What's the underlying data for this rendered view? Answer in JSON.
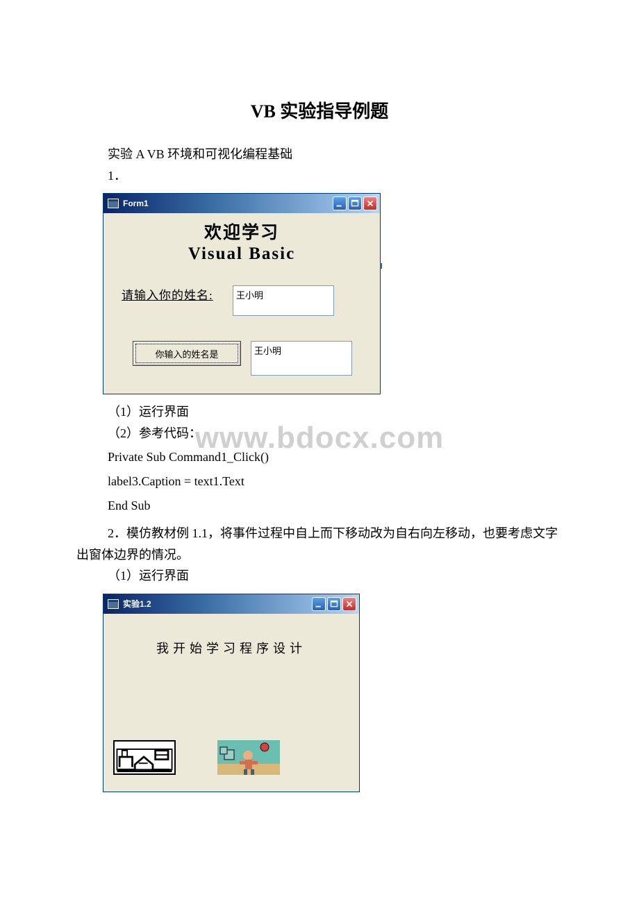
{
  "doc": {
    "title": "VB 实验指导例题",
    "subtitle": "实验 A VB 环境和可视化编程基础",
    "item1": "1．",
    "note1": "（1）运行界面",
    "note2": "（2）参考代码：",
    "code_line1": "Private Sub Command1_Click()",
    "code_line2": "label3.Caption = text1.Text",
    "code_line3": "End Sub",
    "item2": "2．模仿教材例 1.1，将事件过程中自上而下移动改为自右向左移动，也要考虑文字出窗体边界的情况。",
    "note3": "（1）运行界面"
  },
  "form1": {
    "title": "Form1",
    "welcome_line1": "欢迎学习",
    "welcome_line2": "Visual Basic",
    "prompt": "请输入你的姓名:",
    "input_value": "王小明",
    "button_label": "你输入的姓名是",
    "output_value": "王小明"
  },
  "form2": {
    "title": "实验1.2",
    "slogan": "我开始学习程序设计"
  },
  "watermark": "www.bdocx.com"
}
